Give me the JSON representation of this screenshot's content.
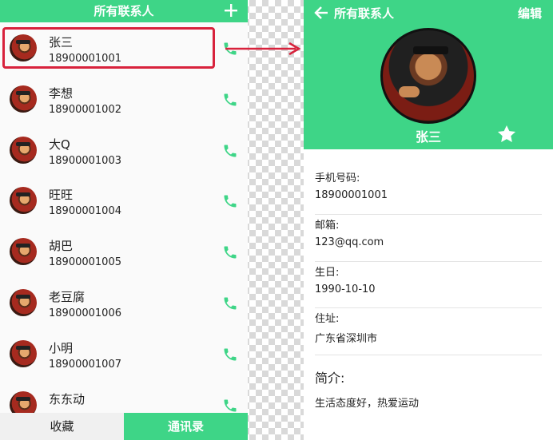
{
  "list_screen": {
    "title": "所有联系人",
    "add_icon": "plus-icon",
    "contacts": [
      {
        "name": "张三",
        "phone": "18900001001"
      },
      {
        "name": "李想",
        "phone": "18900001002"
      },
      {
        "name": "大Q",
        "phone": "18900001003"
      },
      {
        "name": "旺旺",
        "phone": "18900001004"
      },
      {
        "name": "胡巴",
        "phone": "18900001005"
      },
      {
        "name": "老豆腐",
        "phone": "18900001006"
      },
      {
        "name": "小明",
        "phone": "18900001007"
      },
      {
        "name": "东东动",
        "phone": ""
      }
    ],
    "tabs": {
      "favorites": "收藏",
      "contacts": "通讯录"
    },
    "active_tab": "contacts"
  },
  "detail_screen": {
    "back_icon": "arrow-left-icon",
    "title": "所有联系人",
    "edit_label": "编辑",
    "name": "张三",
    "favorite_icon": "star-icon",
    "fields": [
      {
        "label": "手机号码:",
        "value": "18900001001"
      },
      {
        "label": "邮箱:",
        "value": "123@qq.com"
      },
      {
        "label": "生日:",
        "value": "1990-10-10"
      },
      {
        "label": "住址:",
        "value": "广东省深圳市"
      }
    ],
    "bio_title": "简介:",
    "bio_text": "生活态度好，热爱运动"
  },
  "colors": {
    "accent": "#3ed587",
    "highlight": "#d8223c"
  }
}
